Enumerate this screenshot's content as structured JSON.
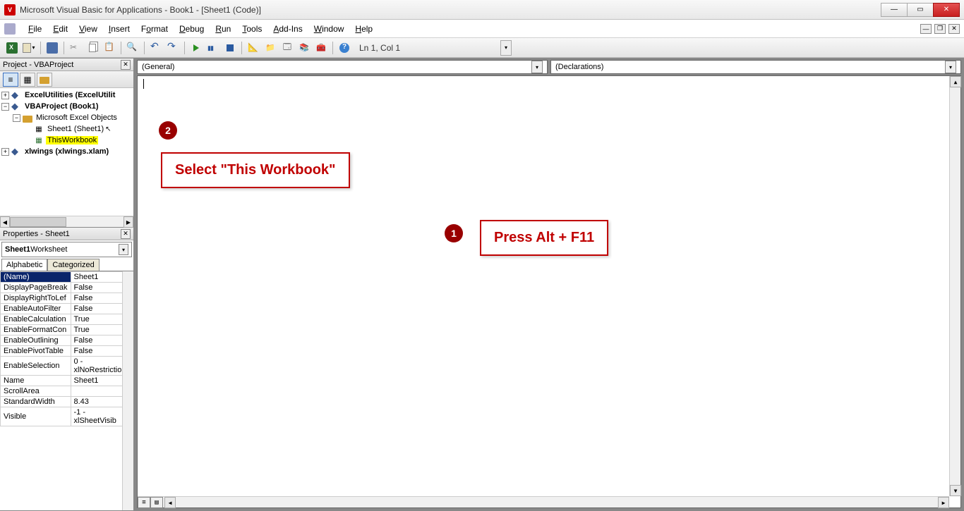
{
  "title": "Microsoft Visual Basic for Applications - Book1 - [Sheet1 (Code)]",
  "menus": {
    "file": "File",
    "edit": "Edit",
    "view": "View",
    "insert": "Insert",
    "format": "Format",
    "debug": "Debug",
    "run": "Run",
    "tools": "Tools",
    "addins": "Add-Ins",
    "window": "Window",
    "help": "Help"
  },
  "toolbar": {
    "status": "Ln 1, Col 1"
  },
  "project_panel": {
    "title": "Project - VBAProject",
    "nodes": {
      "excelutil": "ExcelUtilities (ExcelUtilit",
      "vbaproj": "VBAProject (Book1)",
      "msexcelobj": "Microsoft Excel Objects",
      "sheet1": "Sheet1 (Sheet1)",
      "thisworkbook": "ThisWorkbook",
      "xlwings": "xlwings (xlwings.xlam)"
    }
  },
  "properties_panel": {
    "title": "Properties - Sheet1",
    "object_dd": {
      "name": "Sheet1",
      "type": " Worksheet"
    },
    "tabs": {
      "alphabetic": "Alphabetic",
      "categorized": "Categorized"
    },
    "rows": [
      {
        "name": "(Name)",
        "value": "Sheet1"
      },
      {
        "name": "DisplayPageBreak",
        "value": "False"
      },
      {
        "name": "DisplayRightToLef",
        "value": "False"
      },
      {
        "name": "EnableAutoFilter",
        "value": "False"
      },
      {
        "name": "EnableCalculation",
        "value": "True"
      },
      {
        "name": "EnableFormatCon",
        "value": "True"
      },
      {
        "name": "EnableOutlining",
        "value": "False"
      },
      {
        "name": "EnablePivotTable",
        "value": "False"
      },
      {
        "name": "EnableSelection",
        "value": "0 - xlNoRestrictio"
      },
      {
        "name": "Name",
        "value": "Sheet1"
      },
      {
        "name": "ScrollArea",
        "value": ""
      },
      {
        "name": "StandardWidth",
        "value": "8.43"
      },
      {
        "name": "Visible",
        "value": "-1 - xlSheetVisib"
      }
    ]
  },
  "code_dropdowns": {
    "left": "(General)",
    "right": "(Declarations)"
  },
  "annotations": {
    "n1": "1",
    "n2": "2",
    "box1": "Press Alt + F11",
    "box2": "Select \"This Workbook\""
  }
}
